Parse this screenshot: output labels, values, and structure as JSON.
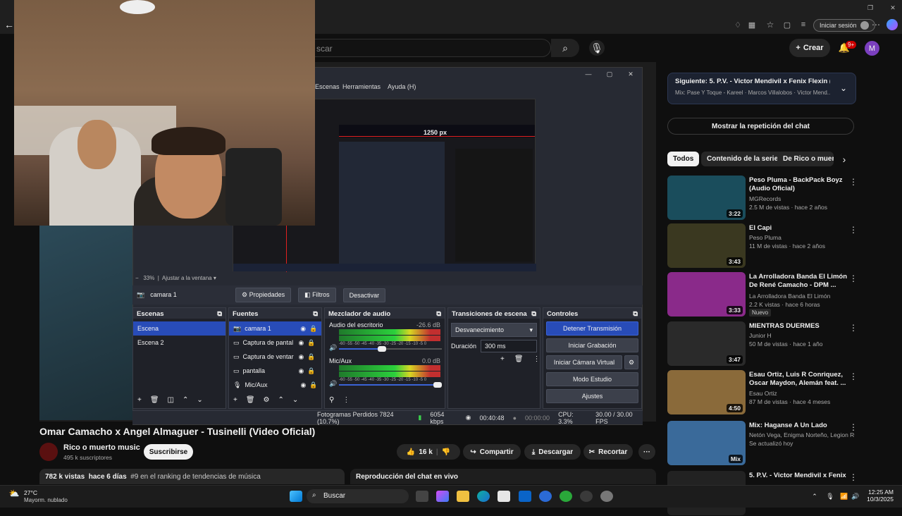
{
  "browser": {
    "signin_label": "Iniciar sesión",
    "profile_letter": "M"
  },
  "youtube_header": {
    "search_placeholder": "scar",
    "create_label": "Crear",
    "notif_count": "9+",
    "avatar_letter": "M"
  },
  "obs": {
    "menu": [
      "Escenas",
      "Herramientas",
      "Ayuda (H)"
    ],
    "preview_label": "1250 px",
    "zoom": "33%",
    "zoom_mode": "Ajustar a la ventana",
    "source_name": "camara 1",
    "properties_label": "Propiedades",
    "filters_label": "Filtros",
    "deactivate_label": "Desactivar",
    "scenes": {
      "title": "Escenas",
      "items": [
        "Escena",
        "Escena 2"
      ]
    },
    "sources": {
      "title": "Fuentes",
      "items": [
        "camara 1",
        "Captura de pantal",
        "Captura de ventar",
        "pantalla",
        "Mic/Aux"
      ]
    },
    "mixer": {
      "title": "Mezclador de audio",
      "channels": [
        {
          "name": "Audio del escritorio",
          "db": "-26.6 dB",
          "level": 0.41
        },
        {
          "name": "Mic/Aux",
          "db": "0.0 dB",
          "level": 1.0
        }
      ],
      "scale": "-60 -55 -50 -45 -40 -35 -30 -25 -20 -15 -10 -5 0"
    },
    "transitions": {
      "title": "Transiciones de escena",
      "type": "Desvanecimiento",
      "duration_label": "Duración",
      "duration_value": "300 ms"
    },
    "controls": {
      "title": "Controles",
      "stop_stream": "Detener Transmisión",
      "start_rec": "Iniciar Grabación",
      "virtual_cam": "Iniciar Cámara Virtual",
      "studio_mode": "Modo Estudio",
      "settings": "Ajustes"
    },
    "status": {
      "dropped": "Fotogramas Perdidos 7824 (10.7%)",
      "bitrate": "6054 kbps",
      "live_time": "00:40:48",
      "rec_time": "00:00:00",
      "cpu": "CPU: 3.3%",
      "fps": "30.00 / 30.00 FPS"
    }
  },
  "video": {
    "title": "Omar Camacho x Angel Almaguer - Tusinelli (Video Oficial)",
    "channel": "Rico o muerto music",
    "subscribers": "495 k suscriptores",
    "subscribe_label": "Suscribirse",
    "likes": "16 k",
    "share": "Compartir",
    "download": "Descargar",
    "clip": "Recortar",
    "more": "···",
    "stats_views": "782 k vistas",
    "stats_date": "hace 6 días",
    "stats_rank": "#9 en el ranking de tendencias de música",
    "live_chat_label": "Reproducción del chat en vivo"
  },
  "sidebar": {
    "next_title": "Siguiente: 5. P.V. - Victor Mendivil x Fenix Flexin (Vi...",
    "next_sub": "Mix: Pase Y Toque - Kareel · Marcos Villalobos · Victor Mend...",
    "show_chat": "Mostrar la repetición del chat",
    "chips": [
      "Todos",
      "Contenido de la serie",
      "De Rico o muerto"
    ],
    "items": [
      {
        "title": "Peso Pluma - BackPack Boyz (Audio Oficial)",
        "channel": "MGRecords",
        "meta": "2.5 M de vistas · hace 2 años",
        "duration": "3:22",
        "thumb": "#1a4d5c"
      },
      {
        "title": "El Capi",
        "channel": "Peso Pluma",
        "meta": "11 M de vistas · hace 2 años",
        "duration": "3:43",
        "thumb": "#3a3820"
      },
      {
        "title": "La Arrolladora Banda El Limón De René Camacho - DPM ...",
        "channel": "La Arrolladora Banda El Limón",
        "meta": "2.2 K vistas · hace 6 horas",
        "duration": "3:33",
        "thumb": "#8a2a8a",
        "badge": "Nuevo"
      },
      {
        "title": "MIENTRAS DUERMES",
        "channel": "Junior H",
        "meta": "50 M de vistas · hace 1 año",
        "duration": "3:47",
        "thumb": "#2a2a2a"
      },
      {
        "title": "Esau Ortiz, Luis R Conriquez, Oscar Maydon, Alemán feat. ...",
        "channel": "Esau Ortiz",
        "meta": "87 M de vistas · hace 4 meses",
        "duration": "4:50",
        "thumb": "#8a6a3a"
      },
      {
        "title": "Mix: Haganse A Un Lado",
        "channel": "Netón Vega, Enigma Norteño, Legion RG ...",
        "meta": "Se actualizó hoy",
        "duration": "Mix",
        "thumb": "#3a6a9a"
      },
      {
        "title": "5. P.V. - Victor Mendivil x Fenix",
        "channel": "",
        "meta": "",
        "duration": "",
        "thumb": "#222"
      }
    ]
  },
  "taskbar": {
    "weather_temp": "27°C",
    "weather_desc": "Mayorm. nublado",
    "search_label": "Buscar",
    "time": "12:25 AM",
    "date": "10/3/2025"
  }
}
